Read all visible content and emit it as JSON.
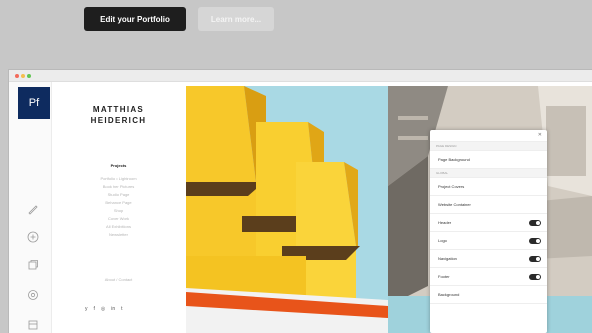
{
  "top_actions": {
    "primary_label": "Edit your Portfolio",
    "secondary_label": "Learn more..."
  },
  "app": {
    "logo_text": "Pf"
  },
  "site": {
    "name_line1": "MATTHIAS",
    "name_line2": "HEIDERICH",
    "menu": [
      "Projects",
      "Portfolio • Lightroom",
      "Book her Pictures",
      "Studio Page",
      "Behance Page",
      "Shop",
      "Cover Work",
      "All Exhibitions",
      "Newsletter"
    ],
    "active_menu_index": 0,
    "contact": "About / Contact",
    "socials": [
      "y",
      "f",
      "◎",
      "in",
      "t"
    ]
  },
  "panel": {
    "sections": [
      {
        "title": "PAGE DESIGN",
        "rows": [
          {
            "label": "Page Background",
            "toggle": false
          }
        ]
      },
      {
        "title": "GLOBAL",
        "rows": [
          {
            "label": "Project Covers",
            "toggle": false
          },
          {
            "label": "Website Container",
            "toggle": false
          },
          {
            "label": "Header",
            "toggle": true
          },
          {
            "label": "Logo",
            "toggle": true
          },
          {
            "label": "Navigation",
            "toggle": true
          },
          {
            "label": "Footer",
            "toggle": true
          },
          {
            "label": "Background",
            "toggle": false
          }
        ]
      }
    ]
  },
  "colors": {
    "accent_dark": "#1e1e1e",
    "logo_bg": "#0e2b5f",
    "building_yellow": "#f5c518",
    "sky": "#a9d9e4",
    "orange": "#e8541a"
  }
}
